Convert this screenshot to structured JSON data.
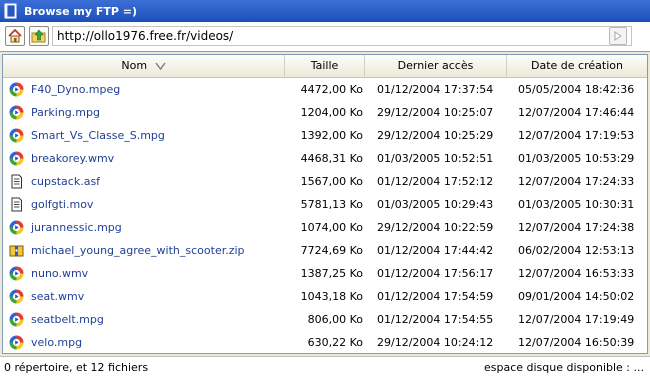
{
  "window": {
    "title": "Browse my FTP =)"
  },
  "toolbar": {
    "url": "http://ollo1976.free.fr/videos/"
  },
  "columns": {
    "name": "Nom",
    "size": "Taille",
    "accessed": "Dernier accès",
    "created": "Date de création"
  },
  "files": [
    {
      "name": "F40_Dyno.mpeg",
      "icon": "media-file-icon",
      "size": "4472,00 Ko",
      "accessed": "01/12/2004  17:37:54",
      "created": "05/05/2004  18:42:36"
    },
    {
      "name": "Parking.mpg",
      "icon": "media-file-icon",
      "size": "1204,00 Ko",
      "accessed": "29/12/2004  10:25:07",
      "created": "12/07/2004  17:46:44"
    },
    {
      "name": "Smart_Vs_Classe_S.mpg",
      "icon": "media-file-icon",
      "size": "1392,00 Ko",
      "accessed": "29/12/2004  10:25:29",
      "created": "12/07/2004  17:19:53"
    },
    {
      "name": "breakorey.wmv",
      "icon": "media-file-icon",
      "size": "4468,31 Ko",
      "accessed": "01/03/2005  10:52:51",
      "created": "01/03/2005  10:53:29"
    },
    {
      "name": "cupstack.asf",
      "icon": "document-file-icon",
      "size": "1567,00 Ko",
      "accessed": "01/12/2004  17:52:12",
      "created": "12/07/2004  17:24:33"
    },
    {
      "name": "golfgti.mov",
      "icon": "document-file-icon",
      "size": "5781,13 Ko",
      "accessed": "01/03/2005  10:29:43",
      "created": "01/03/2005  10:30:31"
    },
    {
      "name": "jurannessic.mpg",
      "icon": "media-file-icon",
      "size": "1074,00 Ko",
      "accessed": "29/12/2004  10:22:59",
      "created": "12/07/2004  17:24:38"
    },
    {
      "name": "michael_young_agree_with_scooter.zip",
      "icon": "zip-archive-icon",
      "size": "7724,69 Ko",
      "accessed": "01/12/2004  17:44:42",
      "created": "06/02/2004  12:53:13"
    },
    {
      "name": "nuno.wmv",
      "icon": "media-file-icon",
      "size": "1387,25 Ko",
      "accessed": "01/12/2004  17:56:17",
      "created": "12/07/2004  16:53:33"
    },
    {
      "name": "seat.wmv",
      "icon": "media-file-icon",
      "size": "1043,18 Ko",
      "accessed": "01/12/2004  17:54:59",
      "created": "09/01/2004  14:50:02"
    },
    {
      "name": "seatbelt.mpg",
      "icon": "media-file-icon",
      "size": "806,00 Ko",
      "accessed": "01/12/2004  17:54:55",
      "created": "12/07/2004  17:19:49"
    },
    {
      "name": "velo.mpg",
      "icon": "media-file-icon",
      "size": "630,22 Ko",
      "accessed": "29/12/2004  10:24:12",
      "created": "12/07/2004  16:50:39"
    }
  ],
  "status": {
    "summary": "0 répertoire, et 12 fichiers",
    "disk": "espace disque disponible : ..."
  }
}
